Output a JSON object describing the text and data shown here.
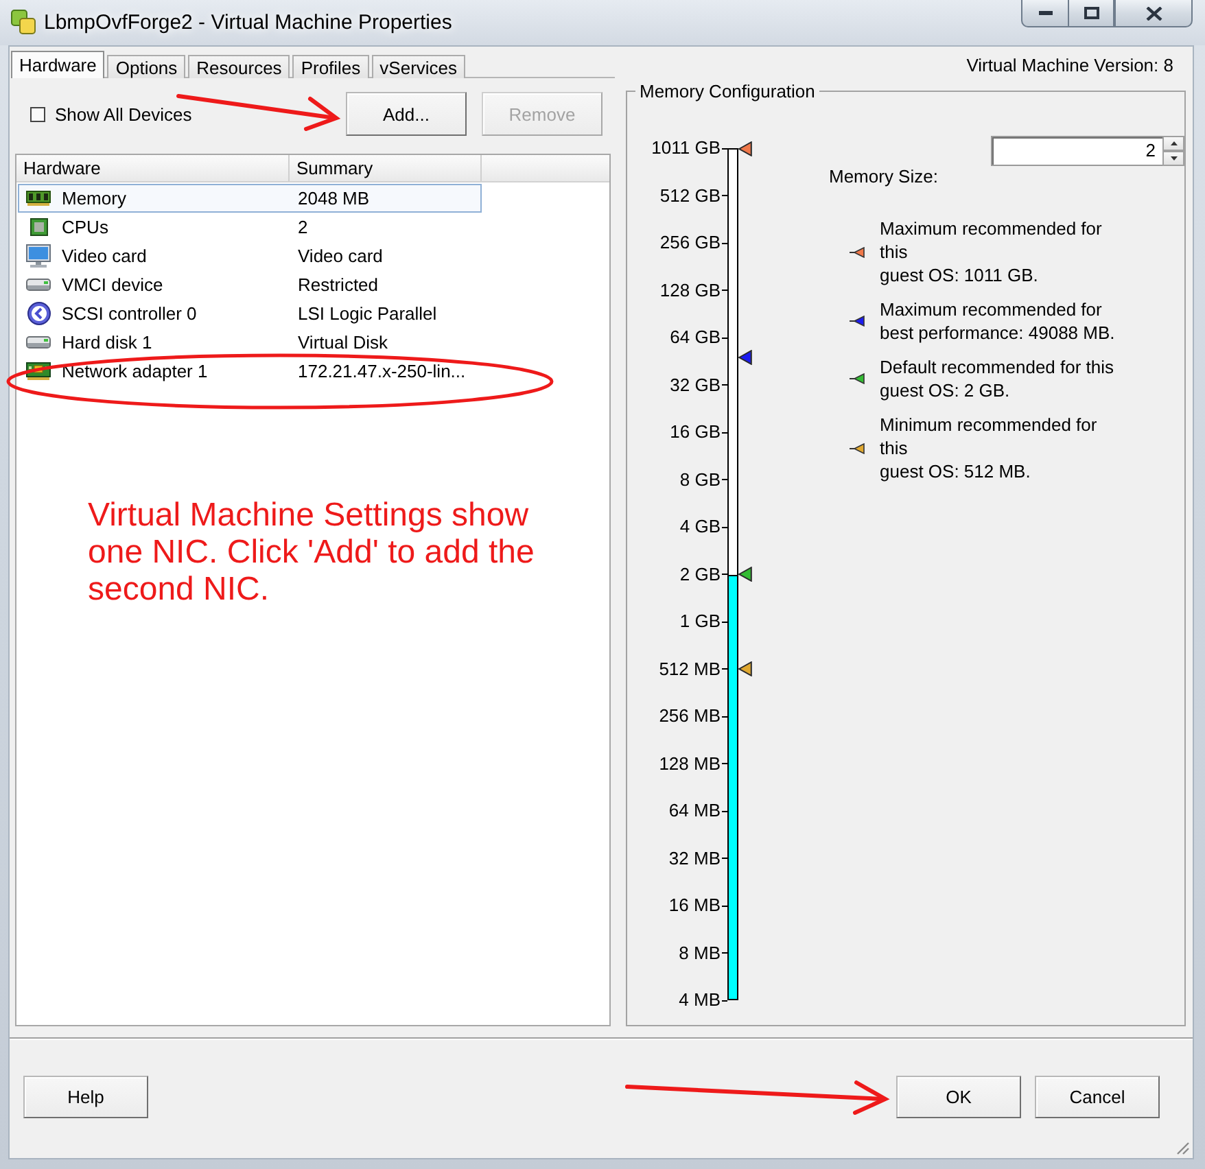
{
  "window": {
    "title": "LbmpOvfForge2 - Virtual Machine Properties"
  },
  "tabs": [
    {
      "label": "Hardware",
      "selected": true
    },
    {
      "label": "Options",
      "selected": false
    },
    {
      "label": "Resources",
      "selected": false
    },
    {
      "label": "Profiles",
      "selected": false
    },
    {
      "label": "vServices",
      "selected": false
    }
  ],
  "version_label": "Virtual Machine Version: 8",
  "hardware_panel": {
    "show_all_devices": {
      "label": "Show All Devices",
      "checked": false
    },
    "buttons": [
      {
        "label": "Add...",
        "disabled": false
      },
      {
        "label": "Remove",
        "disabled": true
      }
    ],
    "table": {
      "columns": [
        "Hardware",
        "Summary"
      ],
      "rows": [
        {
          "kind": "memory",
          "name": "Memory",
          "summary": "2048 MB",
          "selected": true
        },
        {
          "kind": "cpu",
          "name": "CPUs",
          "summary": "2",
          "selected": false
        },
        {
          "kind": "video",
          "name": "Video card",
          "summary": "Video card",
          "selected": false
        },
        {
          "kind": "device",
          "name": "VMCI device",
          "summary": "Restricted",
          "selected": false
        },
        {
          "kind": "scsi",
          "name": "SCSI controller 0",
          "summary": "LSI Logic Parallel",
          "selected": false
        },
        {
          "kind": "disk",
          "name": "Hard disk 1",
          "summary": "Virtual Disk",
          "selected": false
        },
        {
          "kind": "network",
          "name": "Network adapter 1",
          "summary": "172.21.47.x-250-lin...",
          "selected": false
        }
      ]
    }
  },
  "memory_panel": {
    "title": "Memory Configuration",
    "scale": {
      "ticks": [
        "1011 GB",
        "512 GB",
        "256 GB",
        "128 GB",
        "64 GB",
        "32 GB",
        "16 GB",
        "8 GB",
        "4 GB",
        "2 GB",
        "1 GB",
        "512 MB",
        "256 MB",
        "128 MB",
        "64 MB",
        "32 MB",
        "16 MB",
        "8 MB",
        "4 MB"
      ],
      "level": 0.5
    },
    "memory_size": {
      "label": "Memory Size:",
      "value": "2"
    },
    "markers": [
      {
        "text": "Maximum recommended for\nthis\nguest OS: 1011 GB.",
        "color": "#f0784a",
        "level": 1
      },
      {
        "text": "Maximum recommended for\nbest performance: 49088 MB.",
        "color": "#1c1cf0",
        "level": 0.755
      },
      {
        "text": "Default recommended for this\nguest OS: 2 GB.",
        "color": "#33bb33",
        "level": 0.5
      },
      {
        "text": "Minimum recommended for\nthis\nguest OS: 512 MB.",
        "color": "#e0a830",
        "level": 0.389
      }
    ]
  },
  "annotation": {
    "note": "Virtual Machine Settings show one NIC. Click 'Add' to add the second NIC."
  },
  "footer": {
    "left_buttons": [
      "Help"
    ],
    "right_buttons": [
      "OK",
      "Cancel"
    ]
  }
}
